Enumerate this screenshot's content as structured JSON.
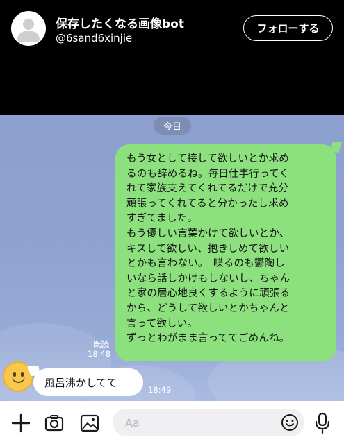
{
  "header": {
    "account_name": "保存したくなる画像bot",
    "account_handle": "@6sand6xinjie",
    "follow_label": "フォローする"
  },
  "chat": {
    "date_label": "今日",
    "outgoing": {
      "lines": [
        "もう女として接して欲しいとか求め",
        "るのも辞めるね。毎日仕事行ってく",
        "れて家族支えてくれてるだけで充分",
        "頑張ってくれてると分かったし求め",
        "すぎてました。",
        "もう優しい言葉かけて欲しいとか、",
        "キスして欲しい、抱きしめて欲しい",
        "とかも言わない。　喋るのも鬱陶し",
        "いなら話しかけもしないし、ちゃん",
        "と家の居心地良くするように頑張る",
        "から、どうして欲しいとかちゃんと",
        "言って欲しい。",
        "ずっとわがまま言っててごめんね。"
      ],
      "read_status": "既読",
      "time": "18:48"
    },
    "incoming": {
      "text": "風呂沸かしてて",
      "time": "18:49",
      "avatar_icon": "smiley-face-icon"
    }
  },
  "input_bar": {
    "placeholder": "Aa",
    "icons": [
      "plus-icon",
      "camera-icon",
      "image-icon",
      "emoji-icon",
      "microphone-icon"
    ]
  },
  "colors": {
    "header_bg": "#000000",
    "outgoing_bubble": "#8ce07d",
    "incoming_bubble": "#ffffff",
    "chat_bg": "#8fa3d3"
  }
}
